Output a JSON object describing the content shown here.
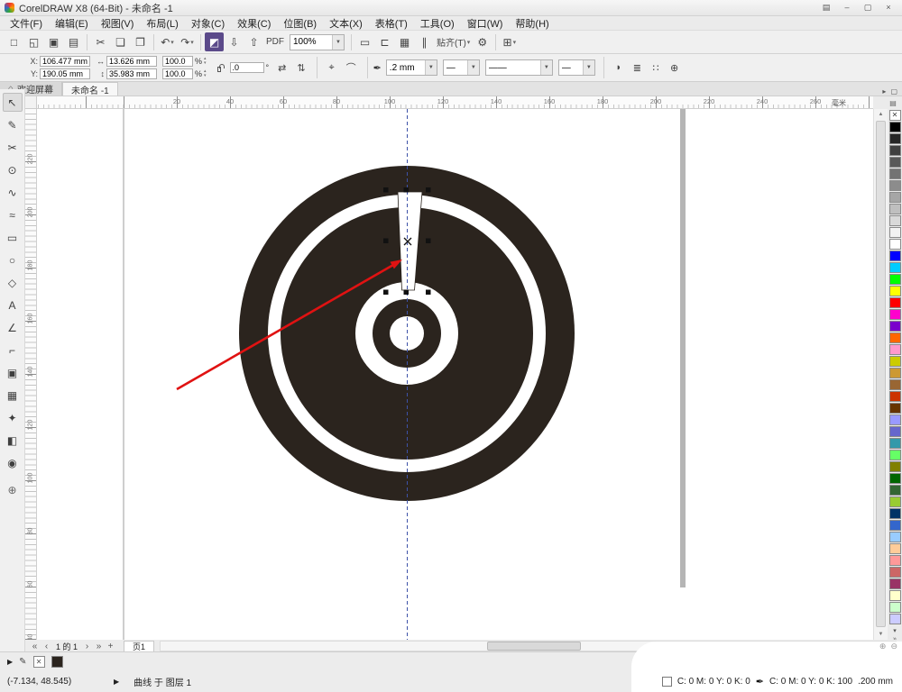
{
  "window": {
    "title": "CorelDRAW X8 (64-Bit) - 未命名 -1",
    "controls": {
      "badge": "▤",
      "min": "–",
      "max": "▢",
      "close": "×"
    }
  },
  "menu": {
    "items": [
      {
        "name": "file",
        "label": "文件(F)"
      },
      {
        "name": "edit",
        "label": "编辑(E)"
      },
      {
        "name": "view",
        "label": "视图(V)"
      },
      {
        "name": "layout",
        "label": "布局(L)"
      },
      {
        "name": "object",
        "label": "对象(C)"
      },
      {
        "name": "effects",
        "label": "效果(C)"
      },
      {
        "name": "bitmaps",
        "label": "位图(B)"
      },
      {
        "name": "text",
        "label": "文本(X)"
      },
      {
        "name": "table",
        "label": "表格(T)"
      },
      {
        "name": "tools",
        "label": "工具(O)"
      },
      {
        "name": "window",
        "label": "窗口(W)"
      },
      {
        "name": "help",
        "label": "帮助(H)"
      }
    ]
  },
  "std_toolbar": {
    "caret_glyph": "▾",
    "dd_glyph": "▼",
    "items": [
      {
        "type": "btn",
        "name": "new-document",
        "glyph": "□"
      },
      {
        "type": "btn",
        "name": "open",
        "glyph": "◱"
      },
      {
        "type": "btn",
        "name": "save",
        "glyph": "▣"
      },
      {
        "type": "btn",
        "name": "print",
        "glyph": "▤"
      },
      {
        "type": "sep"
      },
      {
        "type": "btn",
        "name": "cut",
        "glyph": "✂"
      },
      {
        "type": "btn",
        "name": "copy",
        "glyph": "❏"
      },
      {
        "type": "btn",
        "name": "paste",
        "glyph": "❐"
      },
      {
        "type": "sep"
      },
      {
        "type": "btn",
        "name": "undo",
        "glyph": "↶",
        "caret": true
      },
      {
        "type": "btn",
        "name": "redo",
        "glyph": "↷",
        "caret": true
      },
      {
        "type": "sep"
      },
      {
        "type": "btn",
        "name": "search-content",
        "glyph": "◩",
        "accent": true
      },
      {
        "type": "btn",
        "name": "import",
        "glyph": "⇩"
      },
      {
        "type": "btn",
        "name": "export",
        "glyph": "⇧"
      },
      {
        "type": "btn",
        "name": "publish-pdf",
        "glyph": "PDF",
        "text": true
      },
      {
        "type": "combo",
        "name": "zoom-level",
        "value": "100%"
      },
      {
        "type": "sep"
      },
      {
        "type": "btn",
        "name": "full-screen-preview",
        "glyph": "▭"
      },
      {
        "type": "btn",
        "name": "show-rulers",
        "glyph": "⊏"
      },
      {
        "type": "btn",
        "name": "show-grid",
        "glyph": "▦"
      },
      {
        "type": "btn",
        "name": "show-guidelines",
        "glyph": "∥"
      },
      {
        "type": "textbtn",
        "name": "snap-to",
        "label": "贴齐(T)",
        "caret": true
      },
      {
        "type": "btn",
        "name": "options",
        "glyph": "⚙"
      },
      {
        "type": "sep"
      },
      {
        "type": "btn",
        "name": "app-launcher",
        "glyph": "⊞",
        "caret": true
      }
    ]
  },
  "property_bar": {
    "x_label": "X:",
    "x_value": "106.477 mm",
    "y_label": "Y:",
    "y_value": "190.05 mm",
    "width_value": "13.626 mm",
    "height_value": "35.983 mm",
    "scale_x": "100.0",
    "scale_y": "100.0",
    "percent": "%",
    "rotation_value": ".0",
    "rotation_unit": "°",
    "outline_width": ".2 mm",
    "icons": {
      "width": "↔",
      "height": "↕",
      "mirror_h": "⇄",
      "mirror_v": "⇅",
      "node_edit": "⌖",
      "smooth": "⌒",
      "nib": "✒",
      "line_start": "—",
      "line_style": "——",
      "line_end": "—",
      "close_curve": "◗",
      "wrap": "≣",
      "align": "∷",
      "more": "⊕",
      "spin_up": "▴",
      "spin_down": "▾"
    }
  },
  "tabs": {
    "home_icon": "⌂",
    "welcome": "欢迎屏幕",
    "doc": "未命名 -1",
    "scroll": "▸",
    "panel": "▢"
  },
  "ruler": {
    "h_labels": [
      "20",
      "40",
      "60",
      "80",
      "100",
      "120",
      "140",
      "160",
      "180",
      "200",
      "220",
      "240",
      "260"
    ],
    "v_labels": [
      "220",
      "200",
      "180",
      "160",
      "140",
      "120",
      "100",
      "80",
      "60",
      "40"
    ],
    "units": "毫米",
    "options_icon": "▤"
  },
  "toolbox": {
    "tools": [
      {
        "name": "pick-tool",
        "glyph": "↖",
        "active": true
      },
      {
        "name": "shape-tool",
        "glyph": "✎"
      },
      {
        "name": "crop-tool",
        "glyph": "✂"
      },
      {
        "name": "zoom-tool",
        "glyph": "⊙"
      },
      {
        "name": "freehand-tool",
        "glyph": "∿"
      },
      {
        "name": "artistic-media-tool",
        "glyph": "≈"
      },
      {
        "name": "rectangle-tool",
        "glyph": "▭"
      },
      {
        "name": "ellipse-tool",
        "glyph": "○"
      },
      {
        "name": "polygon-tool",
        "glyph": "◇"
      },
      {
        "name": "text-tool",
        "glyph": "A"
      },
      {
        "name": "dimension-tool",
        "glyph": "∠"
      },
      {
        "name": "connector-tool",
        "glyph": "⌐"
      },
      {
        "name": "drop-shadow-tool",
        "glyph": "▣"
      },
      {
        "name": "transparency-tool",
        "glyph": "▦"
      },
      {
        "name": "eyedropper-tool",
        "glyph": "✦"
      },
      {
        "name": "interactive-fill-tool",
        "glyph": "◧"
      },
      {
        "name": "smart-fill-tool",
        "glyph": "◉"
      },
      {
        "name": "more-tools",
        "glyph": "⊕",
        "more": true
      }
    ]
  },
  "palette": {
    "none_glyph": "✕",
    "colors": [
      "#000000",
      "#262626",
      "#404040",
      "#595959",
      "#737373",
      "#8c8c8c",
      "#a6a6a6",
      "#bfbfbf",
      "#d9d9d9",
      "#f2f2f2",
      "#ffffff",
      "#0000ff",
      "#00ccff",
      "#00ff00",
      "#ffff00",
      "#ff0000",
      "#ff00cc",
      "#7a00cc",
      "#ff6600",
      "#ff99cc",
      "#cccc00",
      "#cc9933",
      "#996633",
      "#cc3300",
      "#663300",
      "#9999ff",
      "#6666cc",
      "#3399aa",
      "#66ff66",
      "#808000",
      "#006600",
      "#336633",
      "#99cc33",
      "#003366",
      "#3366cc",
      "#99ccff",
      "#ffcc99",
      "#ff9999",
      "#cc6666",
      "#993366",
      "#ffffcc",
      "#ccffcc",
      "#ccccff"
    ]
  },
  "canvas": {
    "artwork_color": "#2b241e",
    "guide_color": "#3d52a8",
    "arrow_color": "#e01212",
    "page_edge_color": "#9e9e9e"
  },
  "page_nav": {
    "first": "«",
    "prev": "‹",
    "label": "1 的 1",
    "next": "›",
    "last": "»",
    "add": "+",
    "tab": "页1"
  },
  "scrollbar": {
    "up": "▲",
    "down": "▼"
  },
  "palette_controls": {
    "down": "▾",
    "expand": "»"
  },
  "corner": {
    "zoom_in": "⊕",
    "zoom_out": "⊖"
  },
  "status": {
    "doc_palette_flyout": "▶",
    "doc_palette_eyedropper": "✎",
    "coords": "(-7.134, 48.545)",
    "marker": "▶",
    "object_info": "曲线 于 图层 1",
    "fill_label": "C: 0 M: 0 Y: 0 K: 0",
    "outline_icon": "✒",
    "outline_label": "C: 0 M: 0 Y: 0 K: 100",
    "outline_width": ".200 mm"
  }
}
